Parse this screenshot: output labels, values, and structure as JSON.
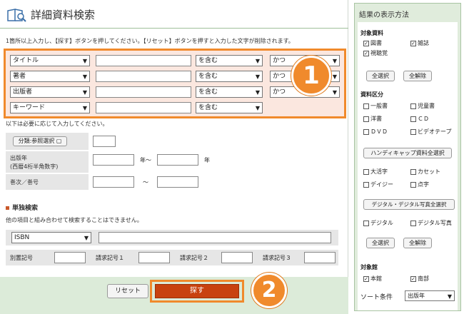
{
  "header": {
    "title": "詳細資料検索"
  },
  "instructions": "1箇所以上入力し、【探す】ボタンを押してください。【リセット】ボタンを押すと入力した文字が削除されます。",
  "advanced": {
    "rows": [
      {
        "field": "タイトル",
        "match": "を含む",
        "op": "かつ"
      },
      {
        "field": "著者",
        "match": "を含む",
        "op": "かつ"
      },
      {
        "field": "出版者",
        "match": "を含む",
        "op": "かつ"
      },
      {
        "field": "キーワード",
        "match": "を含む"
      }
    ]
  },
  "badge1": "1",
  "badge2": "2",
  "subnote": "以下は必要に応じて入力してください。",
  "classification_button": "分類:参照選択",
  "pubyear": {
    "label1": "出版年",
    "label2": "(西暦4桁半角数字)",
    "from_suffix": "年～",
    "to_suffix": "年"
  },
  "volume": {
    "label": "巻次／巻号",
    "sep": "～"
  },
  "single": {
    "title": "単独検索",
    "note": "他の項目と組み合わせて検索することはできません。",
    "select": "ISBN",
    "labels": [
      "別置記号",
      "請求記号１",
      "請求記号２",
      "請求記号３"
    ]
  },
  "footer": {
    "reset": "リセット",
    "search": "探す"
  },
  "sidebar": {
    "title": "結果の表示方法",
    "material": {
      "label": "対象資料",
      "items": [
        "図書",
        "雑誌",
        "視聴覚"
      ],
      "checked": [
        true,
        true,
        true
      ]
    },
    "select_all": "全選択",
    "deselect_all": "全解除",
    "category": {
      "label": "資料区分",
      "items": [
        "一般書",
        "児童書",
        "洋書",
        "ＣＤ",
        "ＤＶＤ",
        "ビデオテープ"
      ]
    },
    "handicap_button": "ハンディキャップ資料全選択",
    "handicap": {
      "items": [
        "大活字",
        "カセット",
        "デイジー",
        "点字"
      ]
    },
    "digital_button": "デジタル・デジタル写真全選択",
    "digital": {
      "items": [
        "デジタル",
        "デジタル写真"
      ]
    },
    "library": {
      "label": "対象館",
      "items": [
        "本館",
        "南部"
      ],
      "checked": [
        true,
        true
      ]
    },
    "sort": {
      "label": "ソート条件",
      "value": "出版年"
    }
  },
  "colors": {
    "accent": "#f08a2c",
    "search_button": "#c8420f",
    "panel_green": "#e0ecdc"
  }
}
